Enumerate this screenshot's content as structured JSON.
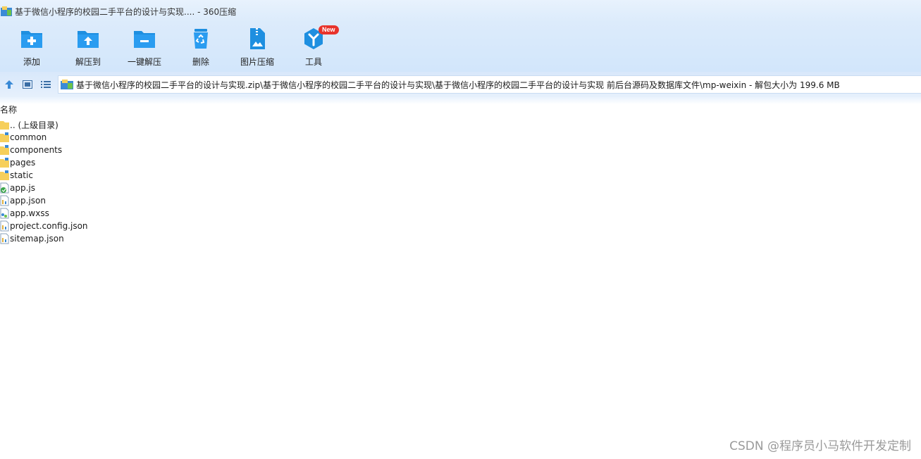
{
  "window": {
    "title": "基于微信小程序的校园二手平台的设计与实现.... - 360压缩"
  },
  "toolbar": {
    "tools": [
      {
        "label": "添加",
        "icon": "add-folder-icon"
      },
      {
        "label": "解压到",
        "icon": "extract-to-icon"
      },
      {
        "label": "一键解压",
        "icon": "one-click-extract-icon"
      },
      {
        "label": "删除",
        "icon": "recycle-bin-icon"
      },
      {
        "label": "图片压缩",
        "icon": "image-compress-icon"
      },
      {
        "label": "工具",
        "icon": "tools-icon",
        "badge": "New"
      }
    ]
  },
  "addressbar": {
    "path": "基于微信小程序的校园二手平台的设计与实现.zip\\基于微信小程序的校园二手平台的设计与实现\\基于微信小程序的校园二手平台的设计与实现 前后台源码及数据库文件\\mp-weixin - 解包大小为 199.6 MB"
  },
  "list": {
    "column_name": "名称",
    "items": [
      {
        "name": ".. (上级目录)",
        "type": "parent"
      },
      {
        "name": "common",
        "type": "folder"
      },
      {
        "name": "components",
        "type": "folder"
      },
      {
        "name": "pages",
        "type": "folder"
      },
      {
        "name": "static",
        "type": "folder"
      },
      {
        "name": "app.js",
        "type": "js"
      },
      {
        "name": "app.json",
        "type": "json"
      },
      {
        "name": "app.wxss",
        "type": "wxss"
      },
      {
        "name": "project.config.json",
        "type": "json"
      },
      {
        "name": "sitemap.json",
        "type": "json"
      }
    ]
  },
  "watermark": "CSDN @程序员小马软件开发定制",
  "colors": {
    "accent": "#1e8fe0",
    "badge": "#e8332b",
    "folder": "#f6cf5b"
  }
}
